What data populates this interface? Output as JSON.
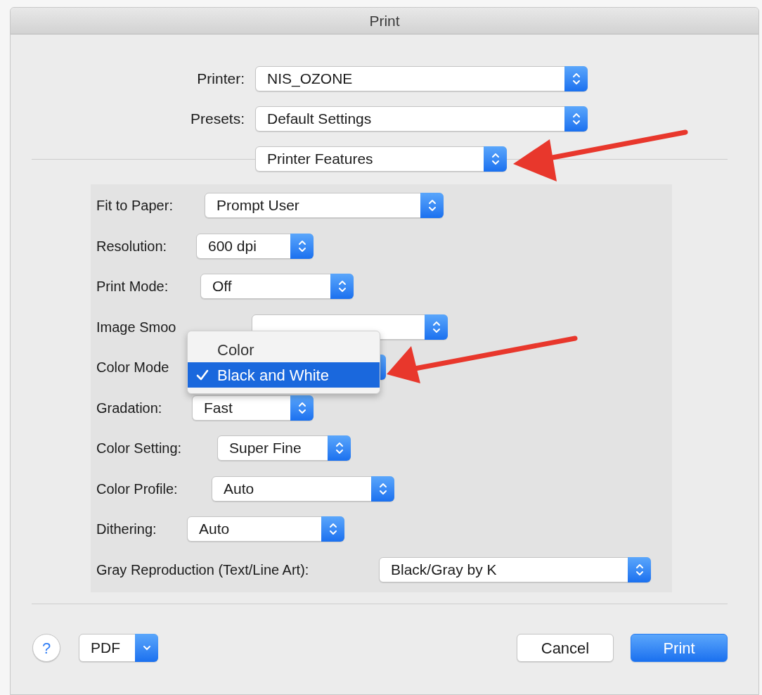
{
  "window": {
    "title": "Print"
  },
  "printer": {
    "label": "Printer:",
    "value": "NIS_OZONE"
  },
  "presets": {
    "label": "Presets:",
    "value": "Default Settings"
  },
  "section": {
    "value": "Printer Features"
  },
  "features": [
    {
      "label": "Fit to Paper:",
      "value": "Prompt User"
    },
    {
      "label": "Resolution:",
      "value": "600 dpi"
    },
    {
      "label": "Print Mode:",
      "value": "Off"
    },
    {
      "label": "Image Smoo"
    },
    {
      "label": "Color Mode"
    },
    {
      "label": "Gradation:",
      "value": "Fast"
    },
    {
      "label": "Color Setting:",
      "value": "Super Fine"
    },
    {
      "label": "Color Profile:",
      "value": "Auto"
    },
    {
      "label": "Dithering:",
      "value": "Auto"
    },
    {
      "label": "Gray Reproduction (Text/Line Art):",
      "value": "Black/Gray by K"
    }
  ],
  "menu": {
    "items": [
      {
        "label": "Color",
        "selected": false
      },
      {
        "label": "Black and White",
        "selected": true
      }
    ]
  },
  "footer": {
    "help": "?",
    "pdf": "PDF",
    "buttons": [
      {
        "label": "Cancel",
        "kind": "secondary"
      },
      {
        "label": "Print",
        "kind": "default"
      }
    ]
  }
}
